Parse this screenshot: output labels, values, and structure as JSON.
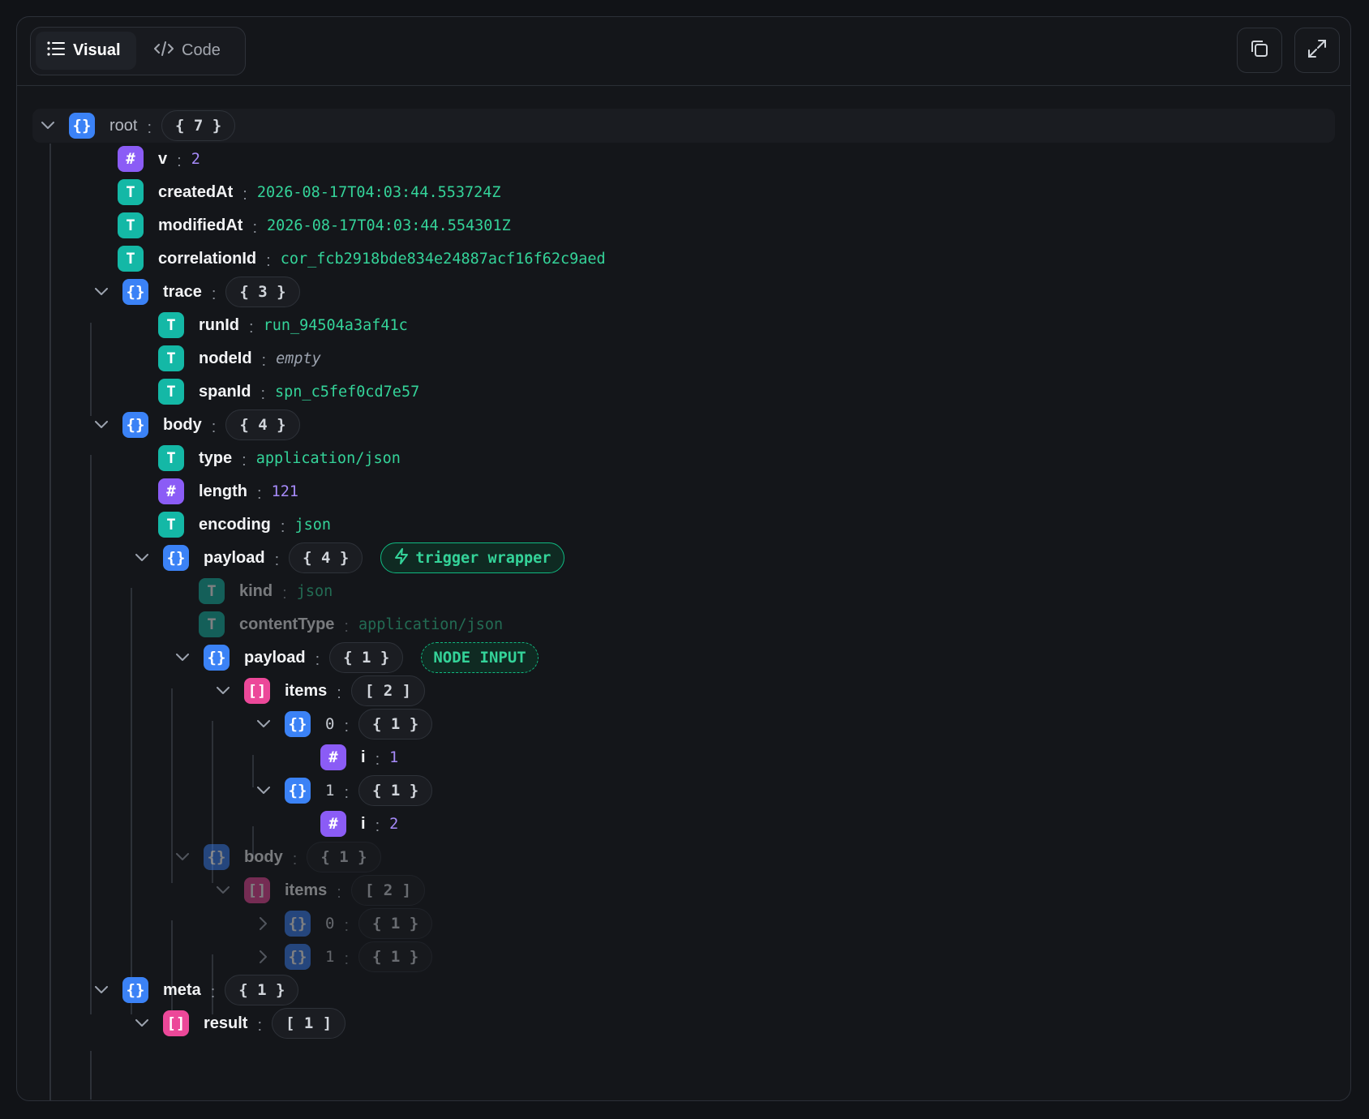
{
  "toolbar": {
    "tabs": [
      {
        "label": "Visual",
        "icon": "list-icon",
        "active": true
      },
      {
        "label": "Code",
        "icon": "code-icon",
        "active": false
      }
    ],
    "actions": [
      {
        "name": "copy-icon"
      },
      {
        "name": "expand-icon"
      }
    ]
  },
  "colors": {
    "object": "#3b82f6",
    "number": "#8b5cf6",
    "string": "#14b8a6",
    "array": "#ec4899",
    "string_value": "#34d399",
    "number_value": "#a78bfa",
    "accent": "#10b981"
  },
  "tree": {
    "root": {
      "key": "root",
      "count": "{ 7 }"
    },
    "v": {
      "key": "v",
      "value": "2"
    },
    "createdAt": {
      "key": "createdAt",
      "value": "2026-08-17T04:03:44.553724Z"
    },
    "modifiedAt": {
      "key": "modifiedAt",
      "value": "2026-08-17T04:03:44.554301Z"
    },
    "correlationId": {
      "key": "correlationId",
      "value": "cor_fcb2918bde834e24887acf16f62c9aed"
    },
    "trace": {
      "key": "trace",
      "count": "{ 3 }"
    },
    "runId": {
      "key": "runId",
      "value": "run_94504a3af41c"
    },
    "nodeId": {
      "key": "nodeId",
      "value": "empty"
    },
    "spanId": {
      "key": "spanId",
      "value": "spn_c5fef0cd7e57"
    },
    "body": {
      "key": "body",
      "count": "{ 4 }"
    },
    "type": {
      "key": "type",
      "value": "application/json"
    },
    "length": {
      "key": "length",
      "value": "121"
    },
    "encoding": {
      "key": "encoding",
      "value": "json"
    },
    "payload": {
      "key": "payload",
      "count": "{ 4 }",
      "badge": "trigger wrapper"
    },
    "kind": {
      "key": "kind",
      "value": "json"
    },
    "contentType": {
      "key": "contentType",
      "value": "application/json"
    },
    "payload_inner": {
      "key": "payload",
      "count": "{ 1 }",
      "badge": "NODE INPUT"
    },
    "items": {
      "key": "items",
      "count": "[ 2 ]"
    },
    "item0": {
      "key": "0",
      "count": "{ 1 }"
    },
    "item0_i": {
      "key": "i",
      "value": "1"
    },
    "item1": {
      "key": "1",
      "count": "{ 1 }"
    },
    "item1_i": {
      "key": "i",
      "value": "2"
    },
    "body_inner": {
      "key": "body",
      "count": "{ 1 }"
    },
    "body_items": {
      "key": "items",
      "count": "[ 2 ]"
    },
    "body_item0": {
      "key": "0",
      "count": "{ 1 }"
    },
    "body_item1": {
      "key": "1",
      "count": "{ 1 }"
    },
    "meta": {
      "key": "meta",
      "count": "{ 1 }"
    },
    "result": {
      "key": "result",
      "count": "[ 1 ]"
    }
  }
}
